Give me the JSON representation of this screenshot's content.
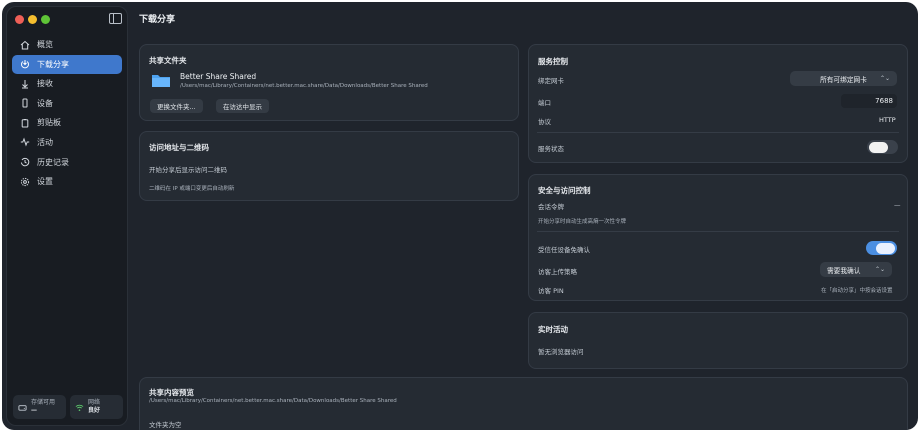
{
  "sidebar": {
    "items": [
      {
        "label": "概览",
        "icon": "home-icon",
        "active": false
      },
      {
        "label": "下载分享",
        "icon": "download-share-icon",
        "active": true
      },
      {
        "label": "接收",
        "icon": "receive-icon",
        "active": false
      },
      {
        "label": "设备",
        "icon": "device-icon",
        "active": false
      },
      {
        "label": "剪贴板",
        "icon": "clipboard-icon",
        "active": false
      },
      {
        "label": "活动",
        "icon": "activity-icon",
        "active": false
      },
      {
        "label": "历史记录",
        "icon": "history-icon",
        "active": false
      },
      {
        "label": "设置",
        "icon": "settings-icon",
        "active": false
      }
    ],
    "storage": {
      "label": "存储可用",
      "value": "—"
    },
    "network": {
      "label": "网络",
      "value": "良好"
    }
  },
  "header": {
    "title": "下载分享"
  },
  "shared_folder": {
    "title": "共享文件夹",
    "name": "Better Share Shared",
    "path": "/Users/mac/Library/Containers/net.better.mac.share/Data/Downloads/Better Share Shared",
    "change_button": "更换文件夹...",
    "reveal_button": "在访达中显示"
  },
  "access": {
    "title": "访问地址与二维码",
    "hint": "开始分享后显示访问二维码",
    "note": "二维码在 IP 或端口变更后自动刷新"
  },
  "service": {
    "title": "服务控制",
    "bind_label": "绑定网卡",
    "bind_value": "所有可绑定网卡",
    "port_label": "端口",
    "port_value": "7688",
    "protocol_label": "协议",
    "protocol_value": "HTTP",
    "status_label": "服务状态",
    "status_on": false
  },
  "security": {
    "title": "安全与访问控制",
    "token_label": "会话令牌",
    "token_value": "—",
    "token_hint": "开始分享时自动生成高熵一次性令牌",
    "trusted_label": "受信任设备免确认",
    "trusted_on": true,
    "upload_label": "访客上传策略",
    "upload_value": "需要我确认",
    "pin_label": "访客 PIN",
    "pin_hint": "在「启动分享」中按会话设置"
  },
  "live": {
    "title": "实时活动",
    "empty": "暂无浏览器访问"
  },
  "preview": {
    "title": "共享内容预览",
    "path": "/Users/mac/Library/Containers/net.better.mac.share/Data/Downloads/Better Share Shared",
    "empty": "文件夹为空"
  },
  "colors": {
    "accent": "#3f78cc",
    "switch_on": "#4b8fe2"
  }
}
